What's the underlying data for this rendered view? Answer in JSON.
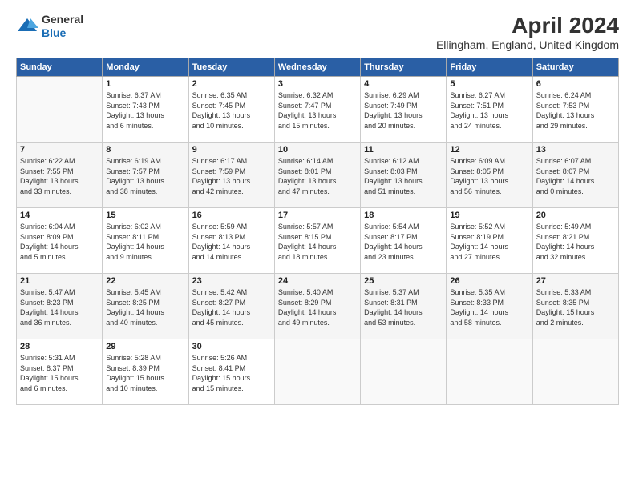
{
  "header": {
    "logo": {
      "line1": "General",
      "line2": "Blue"
    },
    "title": "April 2024",
    "location": "Ellingham, England, United Kingdom"
  },
  "weekdays": [
    "Sunday",
    "Monday",
    "Tuesday",
    "Wednesday",
    "Thursday",
    "Friday",
    "Saturday"
  ],
  "weeks": [
    [
      {
        "day": "",
        "info": ""
      },
      {
        "day": "1",
        "info": "Sunrise: 6:37 AM\nSunset: 7:43 PM\nDaylight: 13 hours\nand 6 minutes."
      },
      {
        "day": "2",
        "info": "Sunrise: 6:35 AM\nSunset: 7:45 PM\nDaylight: 13 hours\nand 10 minutes."
      },
      {
        "day": "3",
        "info": "Sunrise: 6:32 AM\nSunset: 7:47 PM\nDaylight: 13 hours\nand 15 minutes."
      },
      {
        "day": "4",
        "info": "Sunrise: 6:29 AM\nSunset: 7:49 PM\nDaylight: 13 hours\nand 20 minutes."
      },
      {
        "day": "5",
        "info": "Sunrise: 6:27 AM\nSunset: 7:51 PM\nDaylight: 13 hours\nand 24 minutes."
      },
      {
        "day": "6",
        "info": "Sunrise: 6:24 AM\nSunset: 7:53 PM\nDaylight: 13 hours\nand 29 minutes."
      }
    ],
    [
      {
        "day": "7",
        "info": "Sunrise: 6:22 AM\nSunset: 7:55 PM\nDaylight: 13 hours\nand 33 minutes."
      },
      {
        "day": "8",
        "info": "Sunrise: 6:19 AM\nSunset: 7:57 PM\nDaylight: 13 hours\nand 38 minutes."
      },
      {
        "day": "9",
        "info": "Sunrise: 6:17 AM\nSunset: 7:59 PM\nDaylight: 13 hours\nand 42 minutes."
      },
      {
        "day": "10",
        "info": "Sunrise: 6:14 AM\nSunset: 8:01 PM\nDaylight: 13 hours\nand 47 minutes."
      },
      {
        "day": "11",
        "info": "Sunrise: 6:12 AM\nSunset: 8:03 PM\nDaylight: 13 hours\nand 51 minutes."
      },
      {
        "day": "12",
        "info": "Sunrise: 6:09 AM\nSunset: 8:05 PM\nDaylight: 13 hours\nand 56 minutes."
      },
      {
        "day": "13",
        "info": "Sunrise: 6:07 AM\nSunset: 8:07 PM\nDaylight: 14 hours\nand 0 minutes."
      }
    ],
    [
      {
        "day": "14",
        "info": "Sunrise: 6:04 AM\nSunset: 8:09 PM\nDaylight: 14 hours\nand 5 minutes."
      },
      {
        "day": "15",
        "info": "Sunrise: 6:02 AM\nSunset: 8:11 PM\nDaylight: 14 hours\nand 9 minutes."
      },
      {
        "day": "16",
        "info": "Sunrise: 5:59 AM\nSunset: 8:13 PM\nDaylight: 14 hours\nand 14 minutes."
      },
      {
        "day": "17",
        "info": "Sunrise: 5:57 AM\nSunset: 8:15 PM\nDaylight: 14 hours\nand 18 minutes."
      },
      {
        "day": "18",
        "info": "Sunrise: 5:54 AM\nSunset: 8:17 PM\nDaylight: 14 hours\nand 23 minutes."
      },
      {
        "day": "19",
        "info": "Sunrise: 5:52 AM\nSunset: 8:19 PM\nDaylight: 14 hours\nand 27 minutes."
      },
      {
        "day": "20",
        "info": "Sunrise: 5:49 AM\nSunset: 8:21 PM\nDaylight: 14 hours\nand 32 minutes."
      }
    ],
    [
      {
        "day": "21",
        "info": "Sunrise: 5:47 AM\nSunset: 8:23 PM\nDaylight: 14 hours\nand 36 minutes."
      },
      {
        "day": "22",
        "info": "Sunrise: 5:45 AM\nSunset: 8:25 PM\nDaylight: 14 hours\nand 40 minutes."
      },
      {
        "day": "23",
        "info": "Sunrise: 5:42 AM\nSunset: 8:27 PM\nDaylight: 14 hours\nand 45 minutes."
      },
      {
        "day": "24",
        "info": "Sunrise: 5:40 AM\nSunset: 8:29 PM\nDaylight: 14 hours\nand 49 minutes."
      },
      {
        "day": "25",
        "info": "Sunrise: 5:37 AM\nSunset: 8:31 PM\nDaylight: 14 hours\nand 53 minutes."
      },
      {
        "day": "26",
        "info": "Sunrise: 5:35 AM\nSunset: 8:33 PM\nDaylight: 14 hours\nand 58 minutes."
      },
      {
        "day": "27",
        "info": "Sunrise: 5:33 AM\nSunset: 8:35 PM\nDaylight: 15 hours\nand 2 minutes."
      }
    ],
    [
      {
        "day": "28",
        "info": "Sunrise: 5:31 AM\nSunset: 8:37 PM\nDaylight: 15 hours\nand 6 minutes."
      },
      {
        "day": "29",
        "info": "Sunrise: 5:28 AM\nSunset: 8:39 PM\nDaylight: 15 hours\nand 10 minutes."
      },
      {
        "day": "30",
        "info": "Sunrise: 5:26 AM\nSunset: 8:41 PM\nDaylight: 15 hours\nand 15 minutes."
      },
      {
        "day": "",
        "info": ""
      },
      {
        "day": "",
        "info": ""
      },
      {
        "day": "",
        "info": ""
      },
      {
        "day": "",
        "info": ""
      }
    ]
  ]
}
